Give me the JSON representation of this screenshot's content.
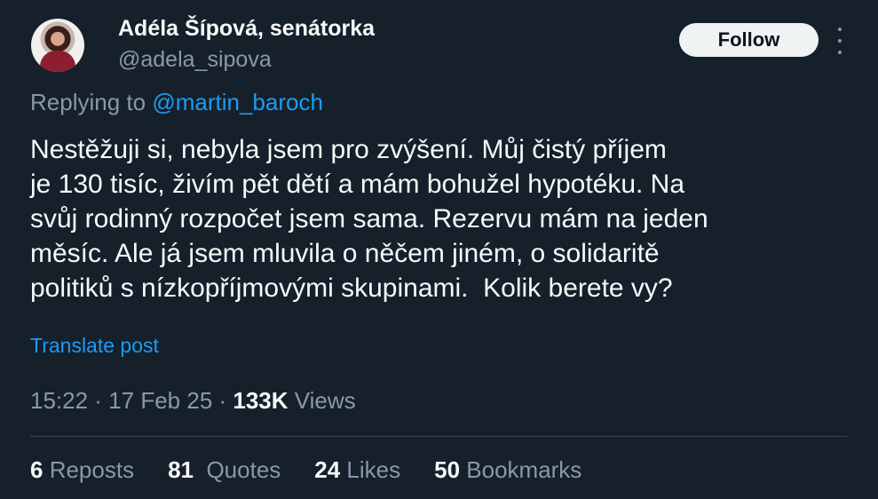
{
  "author": {
    "display_name": "Adéla Šípová, senátorka",
    "handle": "@adela_sipova"
  },
  "follow_label": "Follow",
  "reply": {
    "prefix": "Replying to ",
    "to_handle": "@martin_baroch"
  },
  "tweet": {
    "lines": [
      "Nestěžuji si, nebyla jsem pro zvýšení. Můj čistý příjem",
      "je 130 tisíc, živím pět dětí a mám bohužel hypotéku. Na",
      "svůj rodinný rozpočet jsem sama. Rezervu mám na jeden",
      "měsíc. Ale já jsem mluvila o něčem jiném, o solidaritě",
      "politiků s nízkopříjmovými skupinami.  Kolik berete vy?"
    ]
  },
  "translate_label": "Translate post",
  "meta": {
    "time": "15:22",
    "sep1": " · ",
    "date": "17 Feb 25",
    "sep2": " · ",
    "views_count": "133K",
    "views_label": " Views"
  },
  "stats": {
    "reposts_count": "6",
    "reposts_label": " Reposts",
    "quotes_count": "81",
    "quotes_label": "  Quotes",
    "likes_count": "24",
    "likes_label": " Likes",
    "bookmarks_count": "50",
    "bookmarks_label": " Bookmarks"
  },
  "icons": {
    "more": "more-options-icon"
  },
  "colors": {
    "background": "#15202b",
    "accent": "#1d9bf0",
    "text": "#f7f9f9",
    "muted": "#8b98a5"
  }
}
